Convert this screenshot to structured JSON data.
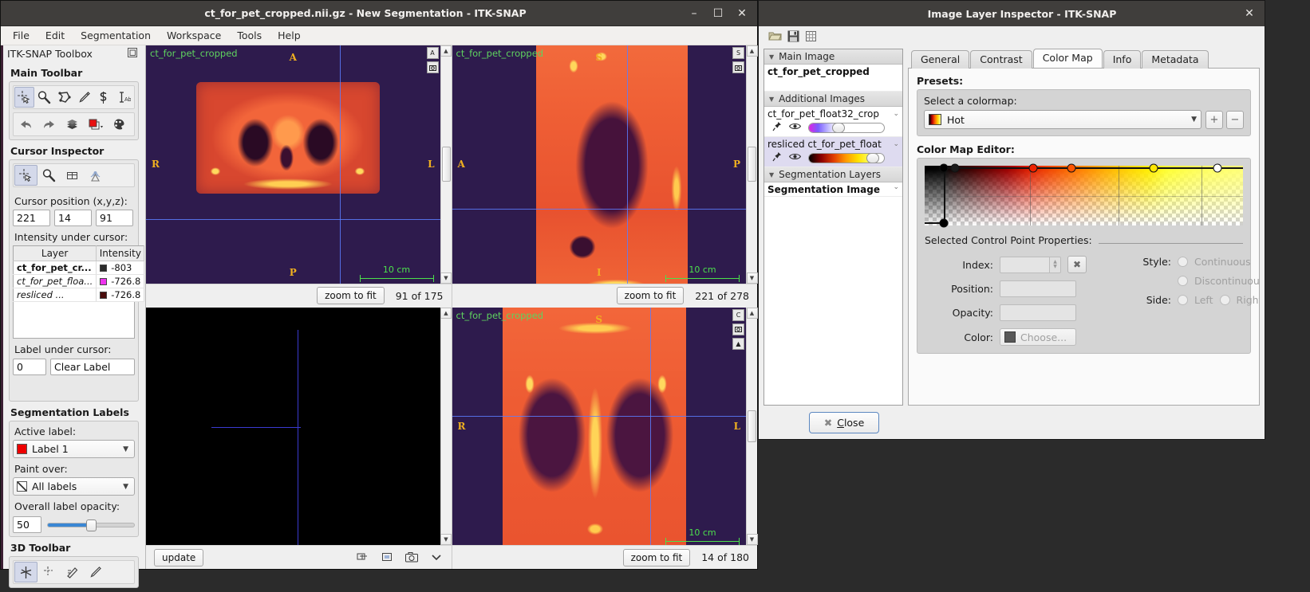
{
  "main_window": {
    "title": "ct_for_pet_cropped.nii.gz - New Segmentation - ITK-SNAP",
    "window_buttons": {
      "minimize": "–",
      "maximize": "☐",
      "close": "✕"
    },
    "menus": [
      "File",
      "Edit",
      "Segmentation",
      "Workspace",
      "Tools",
      "Help"
    ]
  },
  "toolbox": {
    "header": "ITK-SNAP Toolbox",
    "undock_icon": "undock-icon",
    "main_toolbar": {
      "title": "Main Toolbar",
      "row1": [
        "crosshair-tool-icon",
        "zoom-pan-tool-icon",
        "polygon-tool-icon",
        "paintbrush-tool-icon",
        "snake-tool-icon",
        "annotation-tool-icon"
      ],
      "row2": [
        "undo-icon",
        "redo-icon",
        "layers-icon",
        "label-swap-icon",
        "palette-icon"
      ]
    },
    "cursor_inspector": {
      "title": "Cursor Inspector",
      "tools": [
        "crosshair-tool-icon",
        "zoom-pan-tool-icon",
        "grid-icon",
        "broadcast-icon"
      ],
      "cursor_position_label": "Cursor position (x,y,z):",
      "cursor_position": [
        "221",
        "14",
        "91"
      ],
      "intensity_label": "Intensity under cursor:",
      "table": {
        "columns": [
          "Layer",
          "Intensity"
        ],
        "rows": [
          {
            "layer": "ct_for_pet_cr...",
            "color": "#2b2b2b",
            "intensity": "-803",
            "style": "bold"
          },
          {
            "layer": "ct_for_pet_floa...",
            "color": "#ee33ee",
            "intensity": "-726.8",
            "style": "italic"
          },
          {
            "layer": "resliced ...",
            "color": "#4a0d0d",
            "intensity": "-726.8",
            "style": "italic"
          }
        ]
      },
      "label_under_cursor_label": "Label under cursor:",
      "label_under_cursor_id": "0",
      "label_under_cursor_name": "Clear Label"
    },
    "segmentation_labels": {
      "title": "Segmentation Labels",
      "active_label_caption": "Active label:",
      "active_label_value": "Label 1",
      "active_label_color": "#ee0000",
      "paint_over_caption": "Paint over:",
      "paint_over_value": "All labels",
      "opacity_caption": "Overall label opacity:",
      "opacity_value": "50",
      "opacity_percent": 50
    },
    "toolbar_3d": {
      "title": "3D Toolbar",
      "tools": [
        "crosshair-3d-icon",
        "scalpel-3d-icon",
        "spray-3d-icon",
        "paint-3d-icon"
      ]
    }
  },
  "viewports": {
    "axial": {
      "image_name": "ct_for_pet_cropped",
      "orientation_top": "A",
      "orientation_left": "R",
      "orientation_right": "L",
      "orientation_bottom": "P",
      "scale_bar": "10 cm",
      "zoom_button": "zoom to fit",
      "slice_text": "91 of 175"
    },
    "sagittal": {
      "image_name": "ct_for_pet_cropped",
      "orientation_top": "S",
      "orientation_left": "A",
      "orientation_right": "P",
      "orientation_bottom": "I",
      "scale_bar": "10 cm",
      "zoom_button": "zoom to fit",
      "slice_text": "221 of 278"
    },
    "render3d": {
      "update_button": "update",
      "icons": [
        "mesh-icon",
        "crop-icon",
        "camera-icon",
        "chevron-down-icon"
      ]
    },
    "coronal": {
      "image_name": "ct_for_pet_cropped",
      "orientation_top": "S",
      "orientation_left": "R",
      "orientation_right": "L",
      "scale_bar": "10 cm",
      "zoom_button": "zoom to fit",
      "slice_text": "14 of 180"
    }
  },
  "inspector": {
    "title": "Image Layer Inspector - ITK-SNAP",
    "close_x": "✕",
    "toolbar_icons": [
      "open-folder-icon",
      "save-icon",
      "table-icon"
    ],
    "layer_panel": {
      "groups": [
        {
          "name": "Main Image",
          "items": [
            {
              "name": "ct_for_pet_cropped",
              "bold": true,
              "selected": false,
              "has_controls": false
            }
          ]
        },
        {
          "name": "Additional Images",
          "items": [
            {
              "name": "ct_for_pet_float32_crop",
              "bold": false,
              "selected": false,
              "has_controls": true,
              "pin_icon": "pin-icon",
              "eye_icon": "eye-icon",
              "gradient": "linear-gradient(90deg,#e024e0,#7a5cff,#b9b0ff,#ffffff)",
              "knob_pct": 36
            },
            {
              "name": "resliced ct_for_pet_float",
              "bold": false,
              "selected": true,
              "has_controls": true,
              "pin_icon": "pin-icon",
              "eye_icon": "eye-icon",
              "gradient": "linear-gradient(90deg,#000000,#8b0000,#e03c00,#ff9900,#ffe100,#ffff66)",
              "knob_pct": 82
            }
          ]
        },
        {
          "name": "Segmentation Layers",
          "items": [
            {
              "name": "Segmentation Image",
              "bold": true,
              "selected": false,
              "has_controls": false
            }
          ]
        }
      ]
    },
    "tabs": [
      {
        "label": "General",
        "active": false
      },
      {
        "label": "Contrast",
        "active": false
      },
      {
        "label": "Color Map",
        "active": true
      },
      {
        "label": "Info",
        "active": false
      },
      {
        "label": "Metadata",
        "active": false
      }
    ],
    "colormap_tab": {
      "presets_label": "Presets:",
      "select_colormap_label": "Select a colormap:",
      "selected_colormap": "Hot",
      "preset_swatch_gradient": "linear-gradient(90deg,#000000,#c00000,#ff6a00,#ffd000,#ffff99)",
      "add_button": "+",
      "remove_button": "−",
      "editor_label": "Color Map Editor:",
      "editor_gradient": "linear-gradient(90deg, #000000 0%, #050505 6%, #3a0000 14%, #9c0000 26%, #e01f00 33%, #f04000 38%, #ff7a00 48%, #ffab00 56%, #ffd400 64%, #ffec00 70%, #ffff33 76%, #ffff5c 86%, #ffff7a 100%)",
      "control_points": [
        {
          "position": 6,
          "color": "#000000",
          "top": true
        },
        {
          "position": 9.5,
          "color": "#1a1a1a",
          "top": true
        },
        {
          "position": 34,
          "color": "#ee2200",
          "top": true
        },
        {
          "position": 46,
          "color": "#ff5500",
          "top": true
        },
        {
          "position": 72,
          "color": "#ffe600",
          "top": true
        },
        {
          "position": 92,
          "color": "#ffffff",
          "top": true
        },
        {
          "position": 6,
          "color": "#000000",
          "top": false
        }
      ],
      "properties_label": "Selected Control Point Properties:",
      "index_label": "Index:",
      "index_value": "",
      "delete_point_icon": "delete-point-icon",
      "position_label": "Position:",
      "position_value": "",
      "opacity_label": "Opacity:",
      "opacity_value": "",
      "color_label": "Color:",
      "color_button": "Choose...",
      "style_label": "Style:",
      "style_options": [
        "Continuous",
        "Discontinuous"
      ],
      "side_label": "Side:",
      "side_options": [
        "Left",
        "Right"
      ]
    },
    "close_button": "Close"
  }
}
